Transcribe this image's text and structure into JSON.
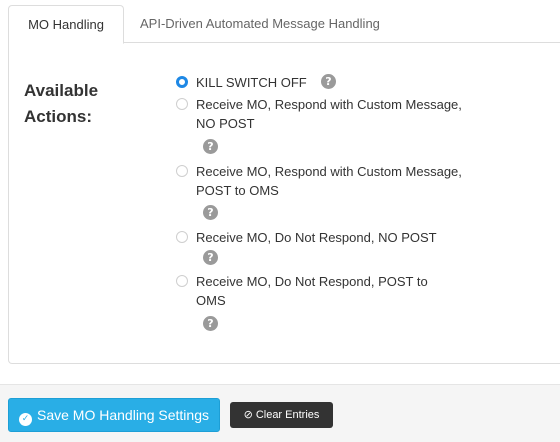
{
  "tabs": [
    {
      "label": "MO Handling",
      "active": true
    },
    {
      "label": "API-Driven Automated Message Handling",
      "active": false
    }
  ],
  "panel": {
    "label": "Available Actions:",
    "options": [
      {
        "text": "KILL SWITCH OFF",
        "checked": true
      },
      {
        "text": "Receive MO, Respond with Custom Message, NO POST",
        "checked": false
      },
      {
        "text": "Receive MO, Respond with Custom Message, POST to OMS",
        "checked": false
      },
      {
        "text": "Receive MO, Do Not Respond, NO POST",
        "checked": false
      },
      {
        "text": "Receive MO, Do Not Respond, POST to OMS",
        "checked": false
      }
    ],
    "help_icon": "question-circle-icon",
    "help_glyph": "?"
  },
  "footer": {
    "save_label": "Save MO Handling Settings",
    "save_icon": "check-circle-icon",
    "clear_label": "Clear Entries",
    "clear_icon": "ban-icon",
    "clear_glyph": "⊘"
  },
  "colors": {
    "accent": "#29aee6",
    "radio_checked": "#1e88e5",
    "dark_button": "#333333",
    "help_icon": "#9a9a9a"
  }
}
